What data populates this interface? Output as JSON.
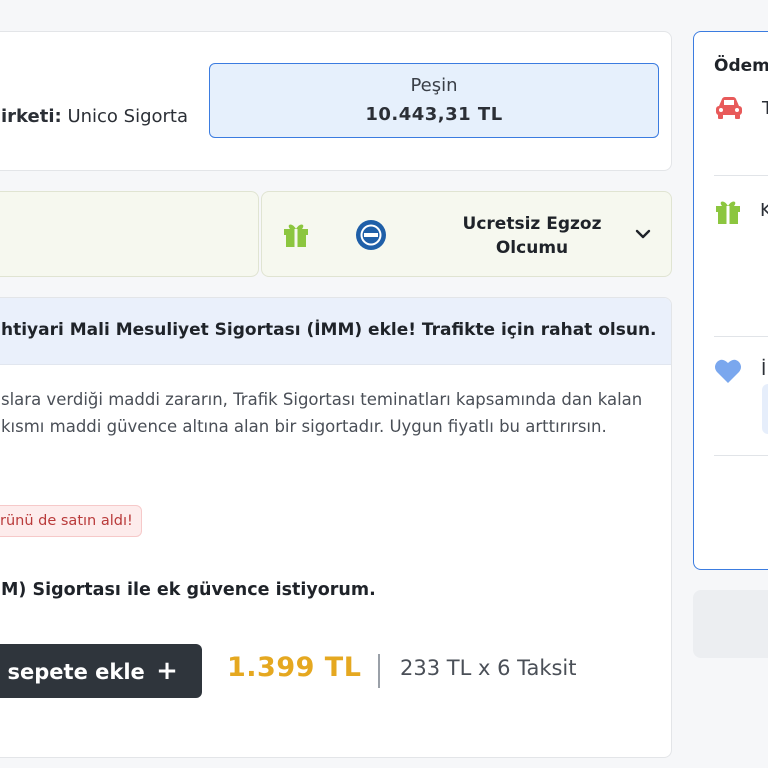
{
  "company": {
    "label": "irketi:",
    "name": "Unico Sigorta"
  },
  "price": {
    "mode": "Peşin",
    "amount": "10.443,31 TL"
  },
  "offers": [
    {
      "icon": "gift-icon",
      "text": "Ucretsiz Egzoz Olcumu",
      "logo": "tuv-logo"
    }
  ],
  "imm": {
    "header": "htiyari Mali Mesuliyet Sigortası (İMM) ekle! Trafikte için rahat olsun.",
    "description": "slara verdiği maddi zararın, Trafik Sigortası teminatları kapsamında dan kalan kısmı maddi güvence altına alan bir sigortadır. Uygun fiyatlı bu arttırırsın.",
    "badge": "rünü de satın aldı!",
    "choice": "M) Sigortası ile ek güvence istiyorum.",
    "button_label": "i sepete ekle",
    "button_plus": "+",
    "price": "1.399 TL",
    "installments": "233 TL x 6 Taksit"
  },
  "sidebar": {
    "title": "Ödem",
    "item1_text": "T",
    "item2_text": "K",
    "item3_text": "İ"
  },
  "colors": {
    "accent_blue": "#3b7ce0",
    "price_orange": "#e5a820",
    "gift_green": "#8cc63f",
    "car_red": "#e85a5a",
    "heart_blue": "#7aa7ee",
    "button_dark": "#2f353c"
  }
}
